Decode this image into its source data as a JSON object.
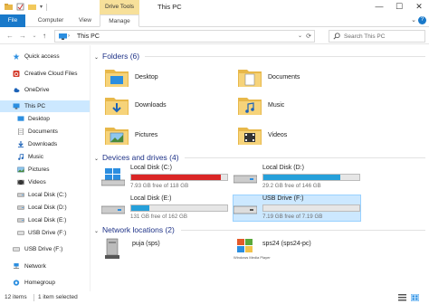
{
  "window": {
    "title": "This PC",
    "context_tab": "Drive Tools",
    "controls": {
      "minimize": "—",
      "maximize": "☐",
      "close": "✕"
    }
  },
  "ribbon": {
    "tabs": [
      "File",
      "Computer",
      "View",
      "Manage"
    ],
    "help": "?"
  },
  "address": {
    "back": "←",
    "forward": "→",
    "recent": "⌄",
    "up": "↑",
    "separator": "›",
    "path": "This PC",
    "refresh": "⟳",
    "search_placeholder": "Search This PC"
  },
  "sidebar": {
    "items": [
      {
        "label": "Quick access",
        "icon": "star-icon"
      },
      {
        "label": "Creative Cloud Files",
        "icon": "creative-cloud-icon"
      },
      {
        "label": "OneDrive",
        "icon": "onedrive-icon"
      },
      {
        "label": "This PC",
        "icon": "pc-icon"
      },
      {
        "label": "Desktop",
        "icon": "desktop-icon"
      },
      {
        "label": "Documents",
        "icon": "documents-icon"
      },
      {
        "label": "Downloads",
        "icon": "downloads-icon"
      },
      {
        "label": "Music",
        "icon": "music-icon"
      },
      {
        "label": "Pictures",
        "icon": "pictures-icon"
      },
      {
        "label": "Videos",
        "icon": "videos-icon"
      },
      {
        "label": "Local Disk (C:)",
        "icon": "disk-icon"
      },
      {
        "label": "Local Disk (D:)",
        "icon": "disk-icon"
      },
      {
        "label": "Local Disk (E:)",
        "icon": "disk-icon"
      },
      {
        "label": "USB Drive (F:)",
        "icon": "usb-icon"
      },
      {
        "label": "USB Drive (F:)",
        "icon": "usb-icon"
      },
      {
        "label": "Network",
        "icon": "network-icon"
      },
      {
        "label": "Homegroup",
        "icon": "homegroup-icon"
      }
    ]
  },
  "groups": {
    "folders": {
      "title": "Folders (6)",
      "items": [
        "Desktop",
        "Documents",
        "Downloads",
        "Music",
        "Pictures",
        "Videos"
      ]
    },
    "devices": {
      "title": "Devices and drives (4)",
      "items": [
        {
          "name": "Local Disk (C:)",
          "free": "7.93 GB free of 118 GB",
          "used_fraction": 0.93,
          "bar_color": "#da2626"
        },
        {
          "name": "Local Disk (D:)",
          "free": "29.2 GB free of 146 GB",
          "used_fraction": 0.8,
          "bar_color": "#26a0da"
        },
        {
          "name": "Local Disk (E:)",
          "free": "131 GB free of 162 GB",
          "used_fraction": 0.19,
          "bar_color": "#26a0da"
        },
        {
          "name": "USB Drive (F:)",
          "free": "7.19 GB free of 7.19 GB",
          "used_fraction": 0.0,
          "bar_color": "#26a0da"
        }
      ]
    },
    "network": {
      "title": "Network locations (2)",
      "items": [
        {
          "name": "puja (sps)",
          "sub": ""
        },
        {
          "name": "sps24 (sps24-pc)",
          "sub": "Windows Media Player"
        }
      ]
    }
  },
  "status": {
    "items": "12 items",
    "selected": "1 item selected"
  },
  "colors": {
    "accent": "#1979ca",
    "selection": "#cce8ff",
    "group_header": "#1e3287",
    "drive_tools": "#f7e09a",
    "bar_low": "#da2626",
    "bar_normal": "#26a0da"
  }
}
